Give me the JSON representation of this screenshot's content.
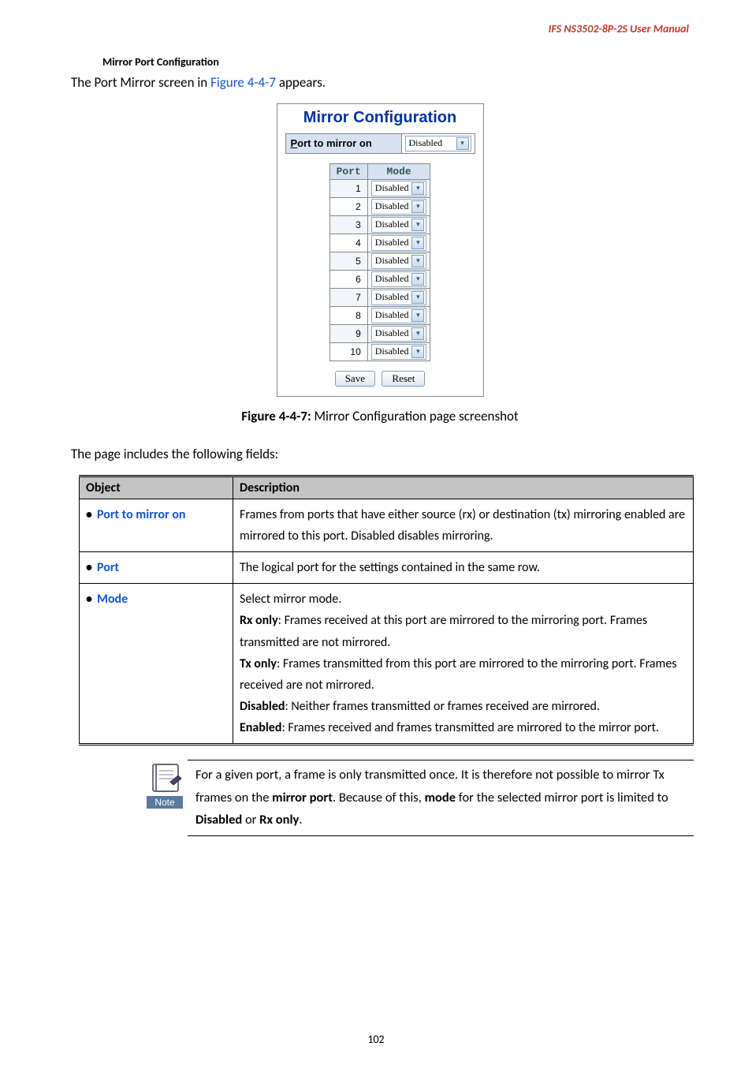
{
  "header": {
    "doc_title": "IFS  NS3502-8P-2S  User  Manual"
  },
  "section_heading": "Mirror Port Configuration",
  "intro": {
    "pre": "The Port Mirror screen in ",
    "link": "Figure 4-4-7",
    "post": " appears."
  },
  "mirror": {
    "title": "Mirror Configuration",
    "port_to_label_u": "P",
    "port_to_label_rest": "ort to mirror on",
    "port_to_value": "Disabled",
    "th_port": "Port",
    "th_mode": "Mode",
    "rows": [
      {
        "port": "1",
        "mode": "Disabled"
      },
      {
        "port": "2",
        "mode": "Disabled"
      },
      {
        "port": "3",
        "mode": "Disabled"
      },
      {
        "port": "4",
        "mode": "Disabled"
      },
      {
        "port": "5",
        "mode": "Disabled"
      },
      {
        "port": "6",
        "mode": "Disabled"
      },
      {
        "port": "7",
        "mode": "Disabled"
      },
      {
        "port": "8",
        "mode": "Disabled"
      },
      {
        "port": "9",
        "mode": "Disabled"
      },
      {
        "port": "10",
        "mode": "Disabled"
      }
    ],
    "btn_save": "Save",
    "btn_reset": "Reset"
  },
  "figure_caption": {
    "bold": "Figure 4-4-7:",
    "rest": " Mirror Configuration page screenshot"
  },
  "fields_intro": "The page includes the following fields:",
  "table": {
    "th_object": "Object",
    "th_description": "Description",
    "rows": [
      {
        "object": "Port to mirror on",
        "description": "Frames from ports that have either source (rx) or destination (tx) mirroring enabled are mirrored to this port. Disabled disables mirroring."
      },
      {
        "object": "Port",
        "description": "The logical port for the settings contained in the same row."
      },
      {
        "object": "Mode",
        "desc_lines": {
          "l1": "Select mirror mode.",
          "l2a": "Rx only",
          "l2b": ": Frames received at this port are mirrored to the mirroring port. Frames transmitted are not mirrored.",
          "l3a": "Tx only",
          "l3b": ": Frames transmitted from this port are mirrored to the mirroring port. Frames received are not mirrored.",
          "l4a": "Disabled",
          "l4b": ": Neither frames transmitted or frames received are mirrored.",
          "l5a": "Enabled",
          "l5b": ": Frames received and frames transmitted are mirrored to the mirror port."
        }
      }
    ]
  },
  "note": {
    "label": "Note",
    "t1": "For a given port, a frame is only transmitted once. It is therefore not possible to mirror Tx frames on the ",
    "b1": "mirror port",
    "t2": ". Because of this, ",
    "b2": "mode",
    "t3": " for the selected mirror port is limited to ",
    "b3": "Disabled",
    "t4": " or ",
    "b4": "Rx only",
    "t5": "."
  },
  "page_number": "102"
}
